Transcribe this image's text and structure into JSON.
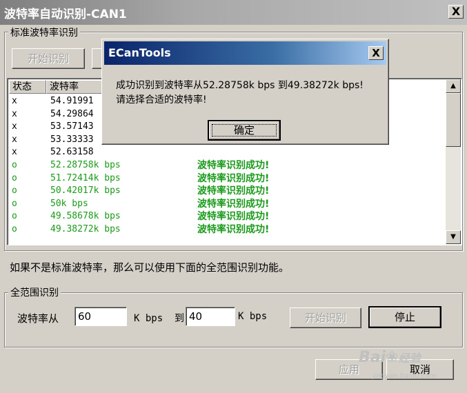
{
  "window": {
    "title": "波特率自动识别-CAN1",
    "close_label": "X"
  },
  "standard_group": {
    "legend": "标准波特率识别",
    "start_button": "开始识别",
    "list_headers": [
      "状态",
      "波特率"
    ],
    "rows": [
      {
        "status": "x",
        "rate": "54.91991",
        "message": "",
        "ok": false
      },
      {
        "status": "x",
        "rate": "54.29864",
        "message": "",
        "ok": false
      },
      {
        "status": "x",
        "rate": "53.57143",
        "message": "",
        "ok": false
      },
      {
        "status": "x",
        "rate": "53.33333",
        "message": "",
        "ok": false
      },
      {
        "status": "x",
        "rate": "52.63158",
        "message": "",
        "ok": false
      },
      {
        "status": "o",
        "rate": "52.28758k bps",
        "message": "波特率识别成功!",
        "ok": true
      },
      {
        "status": "o",
        "rate": "51.72414k bps",
        "message": "波特率识别成功!",
        "ok": true
      },
      {
        "status": "o",
        "rate": "50.42017k bps",
        "message": "波特率识别成功!",
        "ok": true
      },
      {
        "status": "o",
        "rate": "50k bps",
        "message": "波特率识别成功!",
        "ok": true
      },
      {
        "status": "o",
        "rate": "49.58678k bps",
        "message": "波特率识别成功!",
        "ok": true
      },
      {
        "status": "o",
        "rate": "49.38272k bps",
        "message": "波特率识别成功!",
        "ok": true
      }
    ]
  },
  "hint": "如果不是标准波特率，那么可以使用下面的全范围识别功能。",
  "full_range_group": {
    "legend": "全范围识别",
    "from_label": "波特率从",
    "from_value": "60",
    "unit_to_label": "K bps  到",
    "to_value": "40",
    "unit_label": "K bps",
    "start_button": "开始识别",
    "stop_button": "停止"
  },
  "footer": {
    "apply_button": "应用",
    "cancel_button": "取消"
  },
  "watermark": {
    "brand": "Bai",
    "brand2": "经验",
    "url": "jingyan.baidu.com"
  },
  "dialog": {
    "title": "ECanTools",
    "close_label": "X",
    "line1": "成功识别到波特率从52.28758k bps 到49.38272k bps!",
    "line2": "请选择合适的波特率!",
    "ok_button": "确定"
  },
  "colors": {
    "success": "#1a9a1a",
    "dialog_title": "#0a246a"
  }
}
